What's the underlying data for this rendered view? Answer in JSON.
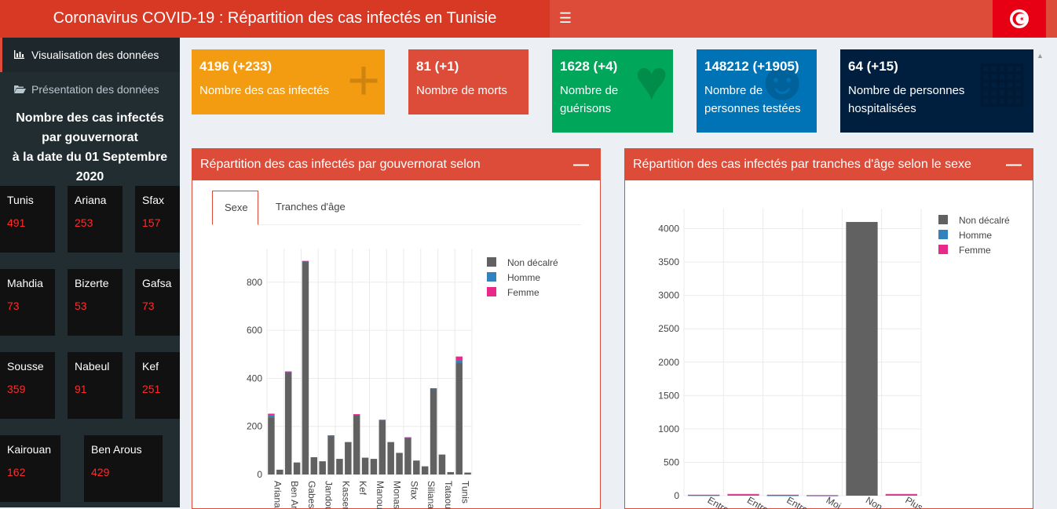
{
  "header": {
    "title": "Coronavirus COVID-19 : Répartition des cas infectés en Tunisie",
    "toggle_icon": "menu-icon",
    "flag_icon": "tunisia-flag-icon",
    "flag_colors": {
      "red": "#e70013",
      "white": "#ffffff"
    }
  },
  "sidebar": {
    "items": [
      {
        "label": "Visualisation des données",
        "icon": "bar-chart-icon",
        "active": true
      },
      {
        "label": "Présentation des données",
        "icon": "folder-open-icon",
        "active": false
      }
    ],
    "title_lines": [
      "Nombre des cas infectés",
      "par gouvernorat",
      "à la date du 01 Septembre",
      "2020"
    ],
    "governorates": [
      {
        "name": "Tunis",
        "value": "491"
      },
      {
        "name": "Ariana",
        "value": "253"
      },
      {
        "name": "Sfax",
        "value": "157"
      },
      {
        "name": "Mahdia",
        "value": "73"
      },
      {
        "name": "Bizerte",
        "value": "53"
      },
      {
        "name": "Gafsa",
        "value": "73"
      },
      {
        "name": "Sousse",
        "value": "359"
      },
      {
        "name": "Nabeul",
        "value": "91"
      },
      {
        "name": "Kef",
        "value": "251"
      },
      {
        "name": "Kairouan",
        "value": "162"
      },
      {
        "name": "Ben Arous",
        "value": "429"
      }
    ]
  },
  "stats": [
    {
      "value": "4196 (+233)",
      "label": "Nombre des cas infectés",
      "color": "#f39c12",
      "icon": "plus-icon"
    },
    {
      "value": "81 (+1)",
      "label": "Nombre de morts",
      "color": "#dd4b39",
      "icon": ""
    },
    {
      "value": "1628 (+4)",
      "label": "Nombre de guérisons",
      "color": "#00a65a",
      "icon": "heartbeat-icon"
    },
    {
      "value": "148212 (+1905)",
      "label": "Nombre de personnes testées",
      "color": "#0073b7",
      "icon": "user-md-icon"
    },
    {
      "value": "64 (+15)",
      "label": "Nombre de personnes hospitalisées",
      "color": "#001f3f",
      "icon": "hospital-icon"
    }
  ],
  "panel_left": {
    "title": "Répartition des cas infectés par gouvernorat selon",
    "tabs": [
      "Sexe",
      "Tranches d'âge"
    ]
  },
  "panel_right": {
    "title": "Répartition des cas infectés par tranches d'âge selon le sexe"
  },
  "colors": {
    "non_declare": "#616161",
    "homme": "#3182bd",
    "femme": "#e7298a"
  },
  "chart_data": [
    {
      "type": "bar",
      "stacked": true,
      "categories": [
        "Ariana",
        "",
        "Ben Arous",
        "",
        "Gabes",
        "",
        "Jendouba",
        "",
        "Kasserine",
        "",
        "Kef",
        "",
        "Manouba",
        "",
        "Monastir",
        "",
        "Sfax",
        "",
        "Siliana",
        "",
        "Tataouine",
        "",
        "Tunis",
        ""
      ],
      "x_tick_labels_visible": [
        "Ariana",
        "Ben Ar",
        "Gabes",
        "Jandou",
        "Kasser",
        "Kef",
        "Manou",
        "Monas",
        "Sfax",
        "Siliana",
        "Tataou",
        "Tunis"
      ],
      "series": [
        {
          "name": "Non décalré",
          "values": [
            238,
            20,
            425,
            50,
            885,
            72,
            55,
            160,
            65,
            135,
            248,
            70,
            65,
            225,
            135,
            90,
            152,
            58,
            34,
            356,
            83,
            10,
            465,
            8
          ]
        },
        {
          "name": "Homme",
          "values": [
            8,
            0,
            2,
            0,
            2,
            0,
            0,
            2,
            0,
            0,
            2,
            0,
            0,
            2,
            0,
            0,
            2,
            0,
            0,
            2,
            0,
            0,
            10,
            0
          ]
        },
        {
          "name": "Femme",
          "values": [
            7,
            0,
            2,
            0,
            2,
            0,
            0,
            1,
            0,
            0,
            1,
            0,
            0,
            1,
            0,
            0,
            1,
            0,
            0,
            1,
            0,
            0,
            16,
            0
          ]
        }
      ],
      "yticks": [
        0,
        200,
        400,
        600,
        800
      ],
      "ylim": [
        0,
        940
      ],
      "grid": true,
      "legend": "top-right"
    },
    {
      "type": "bar",
      "stacked": true,
      "categories": [
        "Entre…",
        "Entre…",
        "Entre…",
        "Moi…",
        "Non…",
        "Plus…"
      ],
      "series": [
        {
          "name": "Non décalré",
          "values": [
            0,
            0,
            0,
            0,
            4100,
            0
          ]
        },
        {
          "name": "Homme",
          "values": [
            8,
            14,
            6,
            4,
            0,
            14
          ]
        },
        {
          "name": "Femme",
          "values": [
            6,
            12,
            8,
            4,
            0,
            12
          ]
        }
      ],
      "yticks": [
        0,
        500,
        1000,
        1500,
        2000,
        2500,
        3000,
        3500,
        4000
      ],
      "ylim": [
        0,
        4300
      ],
      "grid": true,
      "legend": "top-right"
    }
  ]
}
